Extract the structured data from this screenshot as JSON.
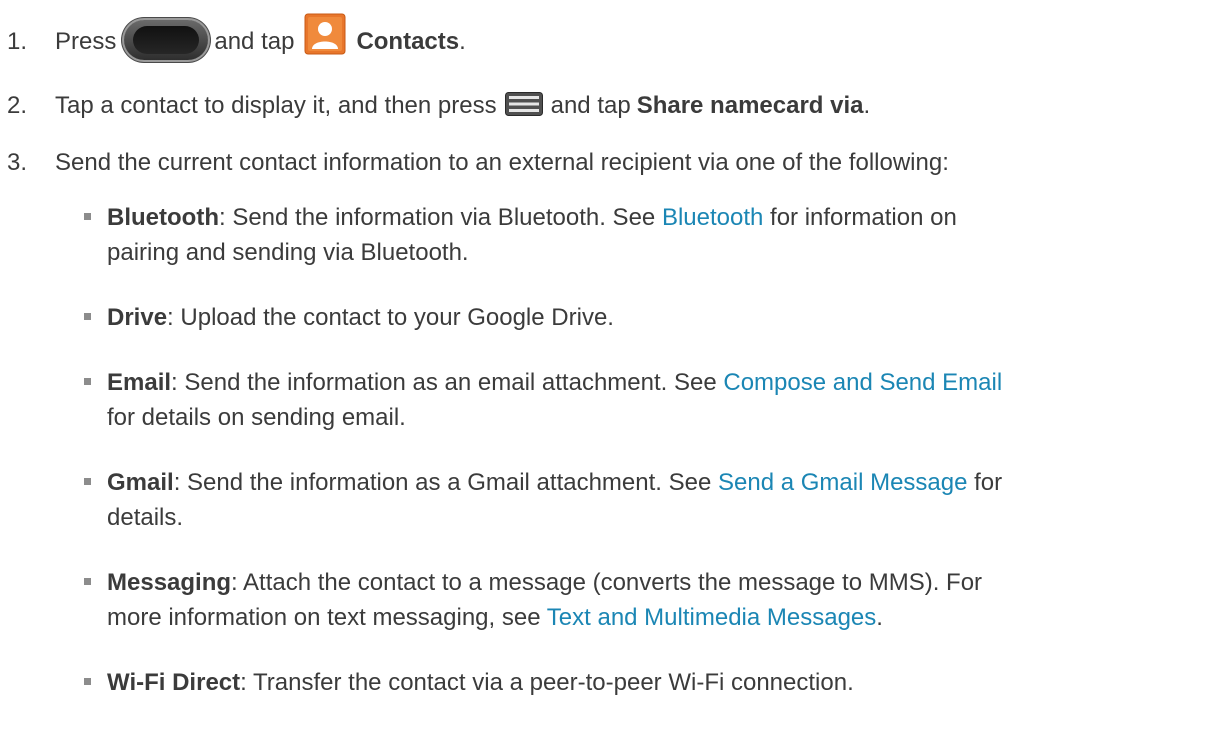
{
  "steps": [
    {
      "number": "1.",
      "parts": {
        "t1": "Press",
        "t2": "and tap",
        "bold": "Contacts",
        "end": "."
      }
    },
    {
      "number": "2.",
      "parts": {
        "t1": "Tap a contact to display it, and then press",
        "t2": "and tap",
        "bold": "Share namecard via",
        "end": "."
      }
    },
    {
      "number": "3.",
      "text": "Send the current contact information to an external recipient via one of the following:"
    }
  ],
  "options": [
    {
      "name": "Bluetooth",
      "lines": [
        {
          "pre": ": Send the information via Bluetooth. See ",
          "link": "Bluetooth",
          "post": " for information on"
        },
        {
          "pre": "pairing and sending via Bluetooth.",
          "link": "",
          "post": ""
        }
      ]
    },
    {
      "name": "Drive",
      "lines": [
        {
          "pre": ": Upload the contact to your Google Drive.",
          "link": "",
          "post": ""
        }
      ]
    },
    {
      "name": "Email",
      "lines": [
        {
          "pre": ": Send the information as an email attachment. See ",
          "link": "Compose and Send Email",
          "post": ""
        },
        {
          "pre": "for details on sending email.",
          "link": "",
          "post": ""
        }
      ]
    },
    {
      "name": "Gmail",
      "lines": [
        {
          "pre": ": Send the information as a Gmail attachment. See ",
          "link": "Send a Gmail Message",
          "post": " for"
        },
        {
          "pre": "details.",
          "link": "",
          "post": ""
        }
      ]
    },
    {
      "name": "Messaging",
      "lines": [
        {
          "pre": ": Attach the contact to a message (converts the message to MMS). For",
          "link": "",
          "post": ""
        },
        {
          "pre": "more information on text messaging, see ",
          "link": "Text and Multimedia Messages",
          "post": "."
        }
      ]
    },
    {
      "name": "Wi-Fi Direct",
      "lines": [
        {
          "pre": ": Transfer the contact via a peer-to-peer Wi-Fi connection.",
          "link": "",
          "post": ""
        }
      ]
    }
  ],
  "icons": {
    "home": "home-key-icon",
    "contacts": "contacts-app-icon",
    "menu": "menu-key-icon",
    "contacts_color": "#e8762b"
  }
}
